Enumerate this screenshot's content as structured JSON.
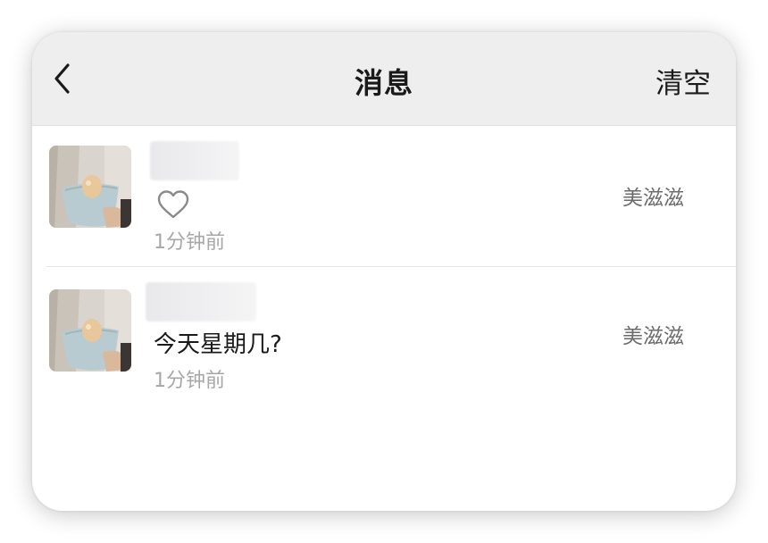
{
  "header": {
    "title": "消息",
    "clear_label": "清空",
    "back_icon": "chevron-left-icon"
  },
  "messages": [
    {
      "avatar": "user-avatar-photo",
      "name_hidden": true,
      "content_icon": "heart-outline-icon",
      "content_text": "",
      "time": "1分钟前",
      "source": "美滋滋"
    },
    {
      "avatar": "user-avatar-photo",
      "name_hidden": true,
      "content_icon": "",
      "content_text": "今天星期几?",
      "time": "1分钟前",
      "source": "美滋滋"
    }
  ],
  "colors": {
    "header_bg": "#eeeeee",
    "text_primary": "#1a1a1a",
    "text_time": "#a7a7a7",
    "text_source": "#6b6b6b"
  }
}
